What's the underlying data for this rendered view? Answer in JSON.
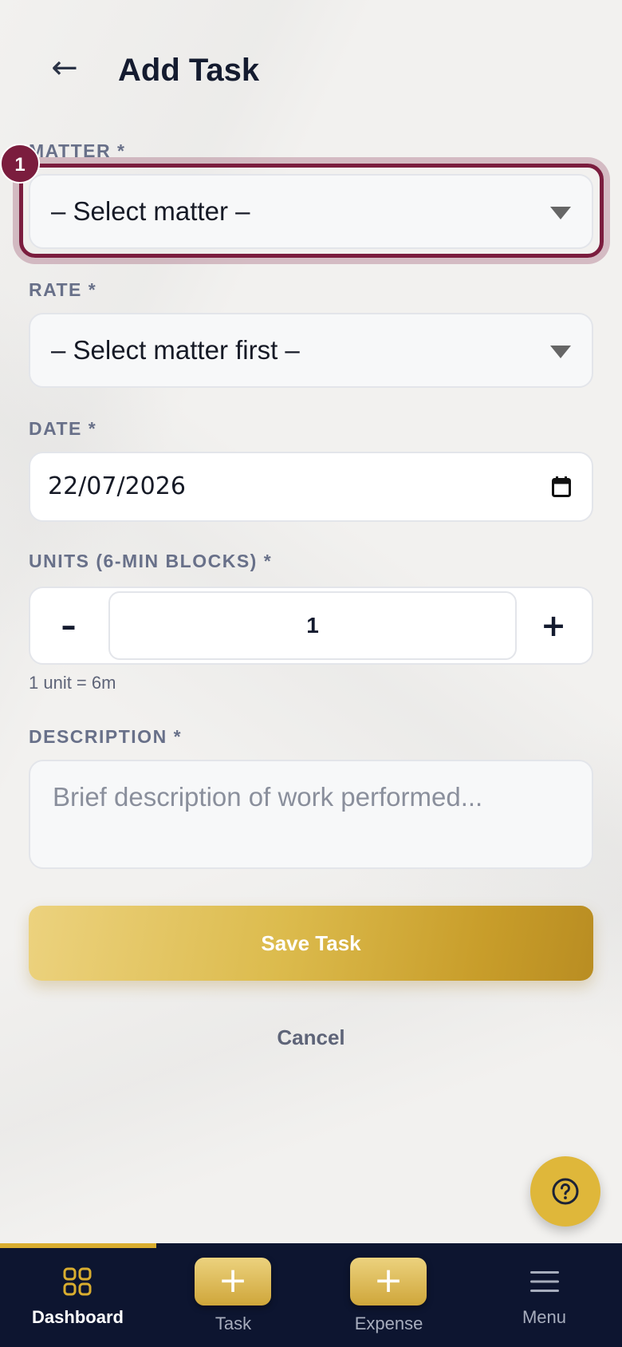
{
  "header": {
    "back_icon": "←",
    "title": "Add Task"
  },
  "step_badge": "1",
  "form": {
    "matter": {
      "label": "MATTER *",
      "value": "– Select matter –"
    },
    "rate": {
      "label": "RATE *",
      "value": "– Select matter first –"
    },
    "date": {
      "label": "DATE *",
      "value": "22/07/2026"
    },
    "units": {
      "label": "UNITS (6-MIN BLOCKS) *",
      "minus": "–",
      "value": "1",
      "plus": "+",
      "hint": "1 unit = 6m"
    },
    "description": {
      "label": "DESCRIPTION *",
      "placeholder": "Brief description of work performed..."
    },
    "save_label": "Save Task",
    "cancel_label": "Cancel"
  },
  "help_fab": {
    "icon": "question-circle-icon"
  },
  "bottom_nav": {
    "items": [
      {
        "label": "Dashboard",
        "icon": "dashboard-grid-icon",
        "active": true
      },
      {
        "label": "Task",
        "icon": "plus",
        "active": false
      },
      {
        "label": "Expense",
        "icon": "plus",
        "active": false
      },
      {
        "label": "Menu",
        "icon": "hamburger-icon",
        "active": false
      }
    ]
  },
  "colors": {
    "accent_gold": "#d9ad2f",
    "highlight_maroon": "#7b1d3e",
    "nav_background": "#0d1530"
  }
}
